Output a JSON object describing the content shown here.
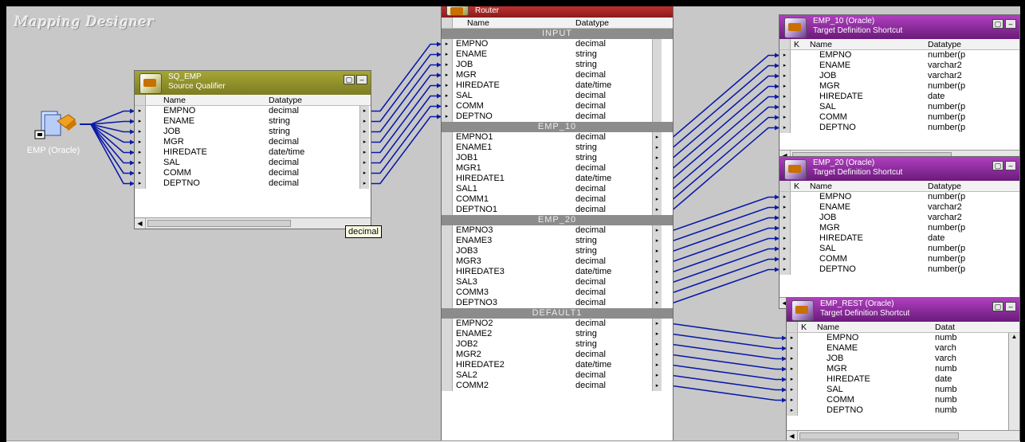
{
  "designer_title": "Mapping Designer",
  "source": {
    "label": "EMP (Oracle)",
    "icon": "oracle-source-icon"
  },
  "qualifier": {
    "name": "SQ_EMP",
    "subtitle": "Source Qualifier",
    "columns": [
      "Name",
      "Datatype"
    ],
    "rows": [
      [
        "EMPNO",
        "decimal"
      ],
      [
        "ENAME",
        "string"
      ],
      [
        "JOB",
        "string"
      ],
      [
        "MGR",
        "decimal"
      ],
      [
        "HIREDATE",
        "date/time"
      ],
      [
        "SAL",
        "decimal"
      ],
      [
        "COMM",
        "decimal"
      ],
      [
        "DEPTNO",
        "decimal"
      ]
    ],
    "tooltip": "decimal"
  },
  "router": {
    "name": "Router",
    "columns": [
      "Name",
      "Datatype"
    ],
    "groups": [
      {
        "title": "INPUT",
        "rows": [
          [
            "EMPNO",
            "decimal"
          ],
          [
            "ENAME",
            "string"
          ],
          [
            "JOB",
            "string"
          ],
          [
            "MGR",
            "decimal"
          ],
          [
            "HIREDATE",
            "date/time"
          ],
          [
            "SAL",
            "decimal"
          ],
          [
            "COMM",
            "decimal"
          ],
          [
            "DEPTNO",
            "decimal"
          ]
        ]
      },
      {
        "title": "EMP_10",
        "rows": [
          [
            "EMPNO1",
            "decimal"
          ],
          [
            "ENAME1",
            "string"
          ],
          [
            "JOB1",
            "string"
          ],
          [
            "MGR1",
            "decimal"
          ],
          [
            "HIREDATE1",
            "date/time"
          ],
          [
            "SAL1",
            "decimal"
          ],
          [
            "COMM1",
            "decimal"
          ],
          [
            "DEPTNO1",
            "decimal"
          ]
        ]
      },
      {
        "title": "EMP_20",
        "rows": [
          [
            "EMPNO3",
            "decimal"
          ],
          [
            "ENAME3",
            "string"
          ],
          [
            "JOB3",
            "string"
          ],
          [
            "MGR3",
            "decimal"
          ],
          [
            "HIREDATE3",
            "date/time"
          ],
          [
            "SAL3",
            "decimal"
          ],
          [
            "COMM3",
            "decimal"
          ],
          [
            "DEPTNO3",
            "decimal"
          ]
        ]
      },
      {
        "title": "DEFAULT1",
        "rows": [
          [
            "EMPNO2",
            "decimal"
          ],
          [
            "ENAME2",
            "string"
          ],
          [
            "JOB2",
            "string"
          ],
          [
            "MGR2",
            "decimal"
          ],
          [
            "HIREDATE2",
            "date/time"
          ],
          [
            "SAL2",
            "decimal"
          ],
          [
            "COMM2",
            "decimal"
          ]
        ]
      }
    ]
  },
  "targets": [
    {
      "name": "EMP_10 (Oracle)",
      "subtitle": "Target Definition Shortcut",
      "columns": [
        "K",
        "Name",
        "Datatype"
      ],
      "rows": [
        [
          "EMPNO",
          "number(p"
        ],
        [
          "ENAME",
          "varchar2"
        ],
        [
          "JOB",
          "varchar2"
        ],
        [
          "MGR",
          "number(p"
        ],
        [
          "HIREDATE",
          "date"
        ],
        [
          "SAL",
          "number(p"
        ],
        [
          "COMM",
          "number(p"
        ],
        [
          "DEPTNO",
          "number(p"
        ]
      ]
    },
    {
      "name": "EMP_20 (Oracle)",
      "subtitle": "Target Definition Shortcut",
      "columns": [
        "K",
        "Name",
        "Datatype"
      ],
      "rows": [
        [
          "EMPNO",
          "number(p"
        ],
        [
          "ENAME",
          "varchar2"
        ],
        [
          "JOB",
          "varchar2"
        ],
        [
          "MGR",
          "number(p"
        ],
        [
          "HIREDATE",
          "date"
        ],
        [
          "SAL",
          "number(p"
        ],
        [
          "COMM",
          "number(p"
        ],
        [
          "DEPTNO",
          "number(p"
        ]
      ]
    },
    {
      "name": "EMP_REST (Oracle)",
      "subtitle": "Target Definition Shortcut",
      "columns": [
        "K",
        "Name",
        "Datat"
      ],
      "rows": [
        [
          "EMPNO",
          "numb"
        ],
        [
          "ENAME",
          "varch"
        ],
        [
          "JOB",
          "varch"
        ],
        [
          "MGR",
          "numb"
        ],
        [
          "HIREDATE",
          "date"
        ],
        [
          "SAL",
          "numb"
        ],
        [
          "COMM",
          "numb"
        ],
        [
          "DEPTNO",
          "numb"
        ]
      ]
    }
  ],
  "colors": {
    "canvas": "#c8c8c8",
    "link": "#0a1aa8",
    "qualifier_header": "#8a8a2a",
    "router_header": "#a02020",
    "target_header": "#7a2a8a"
  }
}
